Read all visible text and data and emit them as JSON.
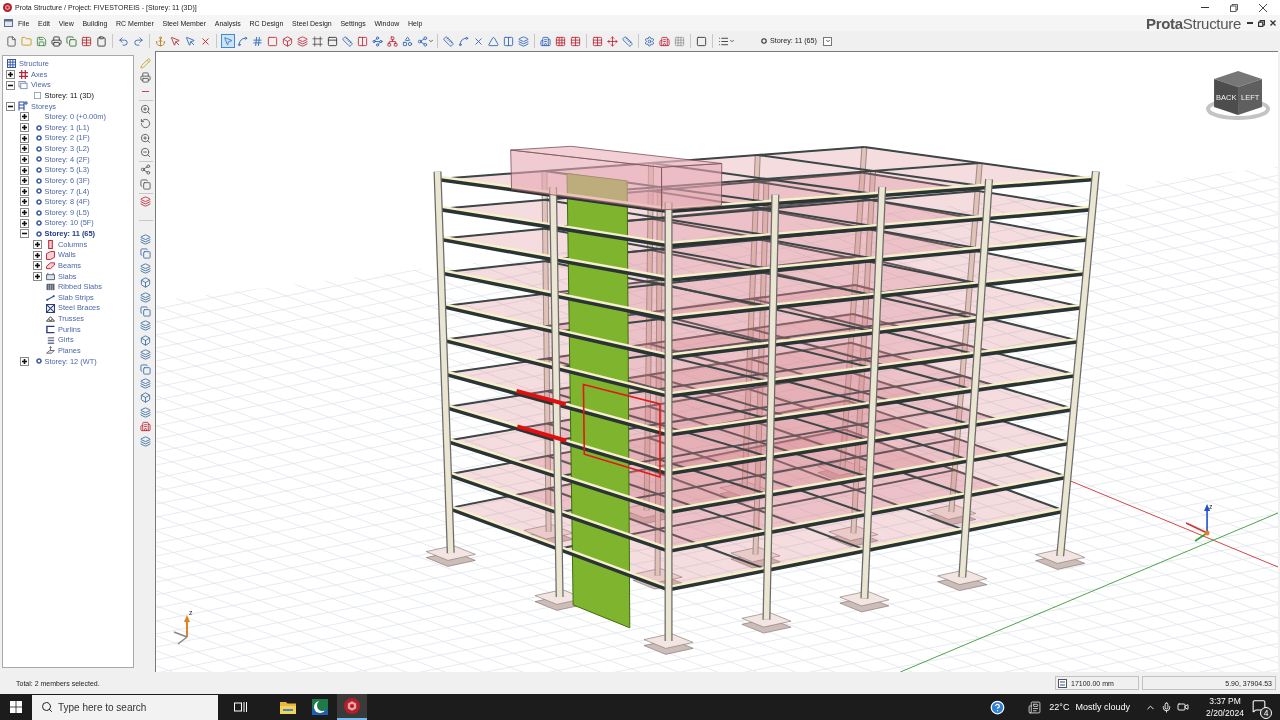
{
  "window": {
    "title": "Prota Structure / Project: FIVESTOREIS - [Storey: 11 (3D)]"
  },
  "menu": [
    "File",
    "Edit",
    "View",
    "Building",
    "RC Member",
    "Steel Member",
    "Analysis",
    "RC Design",
    "Steel Design",
    "Settings",
    "Window",
    "Help"
  ],
  "brand": "**Prota**Structure",
  "toolbar": {
    "select_tool": {
      "selected": true
    },
    "storey_selector": {
      "value": "Storey: 11 (65)"
    }
  },
  "tree": [
    {
      "label": "Structure",
      "kind": "root",
      "selected": false,
      "children": [
        {
          "label": "Axes",
          "kind": "axes",
          "expanded": false,
          "selected": false
        },
        {
          "label": "Views",
          "kind": "views",
          "expanded": true,
          "selected": false,
          "children": [
            {
              "label": "Storey: 11 (3D)",
              "kind": "view",
              "selected": false
            }
          ]
        },
        {
          "label": "Storeys",
          "kind": "storeys",
          "expanded": true,
          "selected": false,
          "children": [
            {
              "label": "Storey: 0 (+0.00m)",
              "kind": "base",
              "expanded": false,
              "selected": false
            },
            {
              "label": "Storey: 1 (L1)",
              "kind": "storey",
              "expanded": false,
              "selected": false
            },
            {
              "label": "Storey: 2 (1F)",
              "kind": "storey",
              "expanded": false,
              "selected": false
            },
            {
              "label": "Storey: 3 (L2)",
              "kind": "storey",
              "expanded": false,
              "selected": false
            },
            {
              "label": "Storey: 4 (2F)",
              "kind": "storey",
              "expanded": false,
              "selected": false
            },
            {
              "label": "Storey: 5 (L3)",
              "kind": "storey",
              "expanded": false,
              "selected": false
            },
            {
              "label": "Storey: 6 (3F)",
              "kind": "storey",
              "expanded": false,
              "selected": false
            },
            {
              "label": "Storey: 7 (L4)",
              "kind": "storey",
              "expanded": false,
              "selected": false
            },
            {
              "label": "Storey: 8 (4F)",
              "kind": "storey",
              "expanded": false,
              "selected": false
            },
            {
              "label": "Storey: 9 (L5)",
              "kind": "storey",
              "expanded": false,
              "selected": false
            },
            {
              "label": "Storey: 10 (5F)",
              "kind": "storey",
              "expanded": false,
              "selected": false
            },
            {
              "label": "Storey: 11 (65)",
              "kind": "storey",
              "expanded": true,
              "selected": true,
              "children": [
                {
                  "label": "Columns",
                  "kind": "member",
                  "expanded": false,
                  "selected": false
                },
                {
                  "label": "Walls",
                  "kind": "member",
                  "expanded": false,
                  "selected": false
                },
                {
                  "label": "Beams",
                  "kind": "member",
                  "expanded": false,
                  "selected": false
                },
                {
                  "label": "Slabs",
                  "kind": "member",
                  "expanded": false,
                  "selected": false
                },
                {
                  "label": "Ribbed Slabs",
                  "kind": "member",
                  "selected": false
                },
                {
                  "label": "Slab Strips",
                  "kind": "member",
                  "selected": false
                },
                {
                  "label": "Steel Braces",
                  "kind": "member",
                  "selected": false
                },
                {
                  "label": "Trusses",
                  "kind": "member",
                  "selected": false
                },
                {
                  "label": "Purlins",
                  "kind": "member",
                  "selected": false
                },
                {
                  "label": "Girts",
                  "kind": "member",
                  "selected": false
                },
                {
                  "label": "Planes",
                  "kind": "member",
                  "selected": false
                }
              ]
            },
            {
              "label": "Storey: 12 (WT)",
              "kind": "storey",
              "expanded": false,
              "selected": false
            }
          ]
        }
      ]
    }
  ],
  "viewport": {
    "view_cube": {
      "faces": [
        "BACK",
        "LEFT"
      ]
    },
    "axis_triads": [
      {
        "label": "z"
      },
      {
        "label": "z"
      }
    ]
  },
  "status_bar": {
    "message": "Total: 2 members selected.",
    "elevation": "17100.00 mm",
    "coordinates": "5.90, 37904.53"
  },
  "taskbar": {
    "search": {
      "placeholder": "Type here to search"
    },
    "apps": [
      {
        "kind": "explorer",
        "selected": false
      },
      {
        "kind": "app",
        "selected": false
      },
      {
        "kind": "prota",
        "selected": true
      }
    ],
    "weather": {
      "temperature": "22°C",
      "condition": "Mostly cloudy"
    },
    "clock": {
      "time": "3:37 PM",
      "date": "2/20/2024"
    },
    "notifications": "4"
  }
}
